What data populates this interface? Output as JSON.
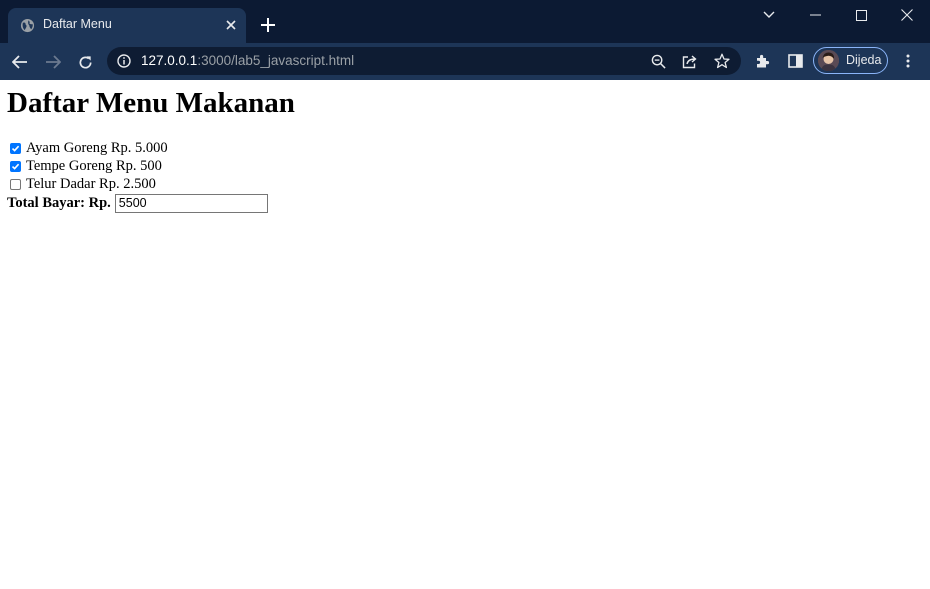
{
  "browser": {
    "tab": {
      "title": "Daftar Menu"
    },
    "address_bar": {
      "host": "127.0.0.1",
      "rest": ":3000/lab5_javascript.html"
    },
    "profile": {
      "name": "Dijeda"
    },
    "colors": {
      "frame": "#0c1a33",
      "toolbar": "#1d3557",
      "omnibox": "#0e1c33",
      "accent": "#8ab4f8"
    }
  },
  "page": {
    "heading": "Daftar Menu Makanan",
    "menu_items": [
      {
        "label": "Ayam Goreng Rp. 5.000",
        "checked": true
      },
      {
        "label": "Tempe Goreng Rp. 500",
        "checked": true
      },
      {
        "label": "Telur Dadar Rp. 2.500",
        "checked": false
      }
    ],
    "total": {
      "label": "Total Bayar: Rp.",
      "value": "5500"
    },
    "colors": {
      "checkbox_checked": "#0075ff"
    }
  }
}
